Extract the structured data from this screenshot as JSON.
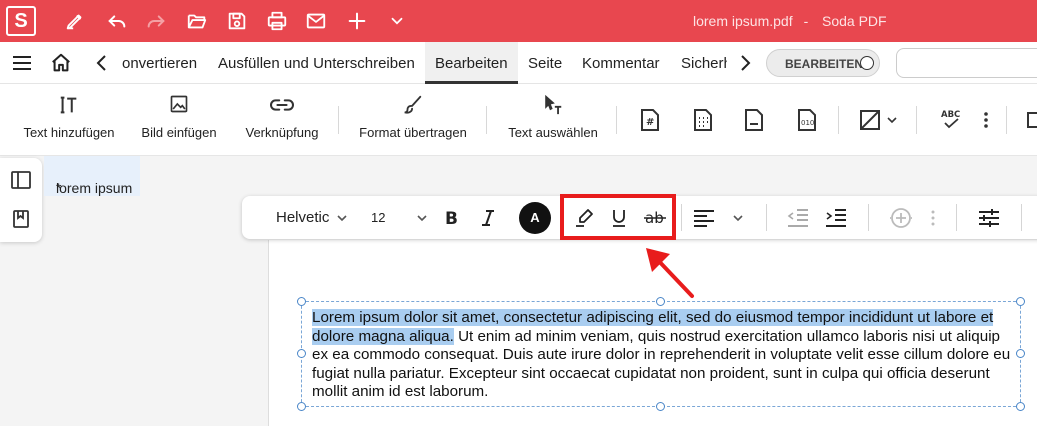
{
  "app": {
    "logo_letter": "S",
    "window_title": "lorem ipsum.pdf",
    "app_name": "Soda PDF",
    "accent_color": "#e8474f"
  },
  "menu": {
    "tabs": [
      {
        "label": "onvertieren"
      },
      {
        "label": "Ausfüllen und Unterschreiben"
      },
      {
        "label": "Bearbeiten",
        "active": true
      },
      {
        "label": "Seite"
      },
      {
        "label": "Kommentar"
      },
      {
        "label": "Sicherh"
      }
    ],
    "edit_toggle_label": "BEARBEITEN"
  },
  "ribbon": {
    "items": [
      {
        "label": "Text hinzufügen",
        "icon": "add-text-icon"
      },
      {
        "label": "Bild einfügen",
        "icon": "image-icon"
      },
      {
        "label": "Verknüpfung",
        "icon": "link-icon"
      },
      {
        "label": "Format übertragen",
        "icon": "brush-icon"
      },
      {
        "label": "Text auswählen",
        "icon": "select-text-icon"
      }
    ],
    "icons_right": [
      "header-footer-icon",
      "bates-icon",
      "page-number-icon",
      "binary-icon",
      "crop-icon",
      "spellcheck-icon",
      "more-icon",
      "exit-icon"
    ]
  },
  "document": {
    "tab_label": "lorem ipsum",
    "tab_modified_mark": "*",
    "text_selected": "Lorem ipsum dolor sit amet, consectetur adipiscing elit, sed do eiusmod tempor incididunt ut labore et dolore magna aliqua.",
    "text_rest": " Ut enim ad minim veniam, quis nostrud exercitation ullamco laboris nisi ut aliquip ex ea commodo consequat. Duis aute irure dolor in reprehenderit in voluptate velit esse cillum dolore eu fugiat nulla pariatur. Excepteur sint occaecat cupidatat non proident, sunt in culpa qui officia deserunt mollit anim id est laborum."
  },
  "format_toolbar": {
    "font_family": "Helvetic",
    "font_size": "12",
    "color_button_letter": "A",
    "annotation_color": "#e81c1c"
  }
}
